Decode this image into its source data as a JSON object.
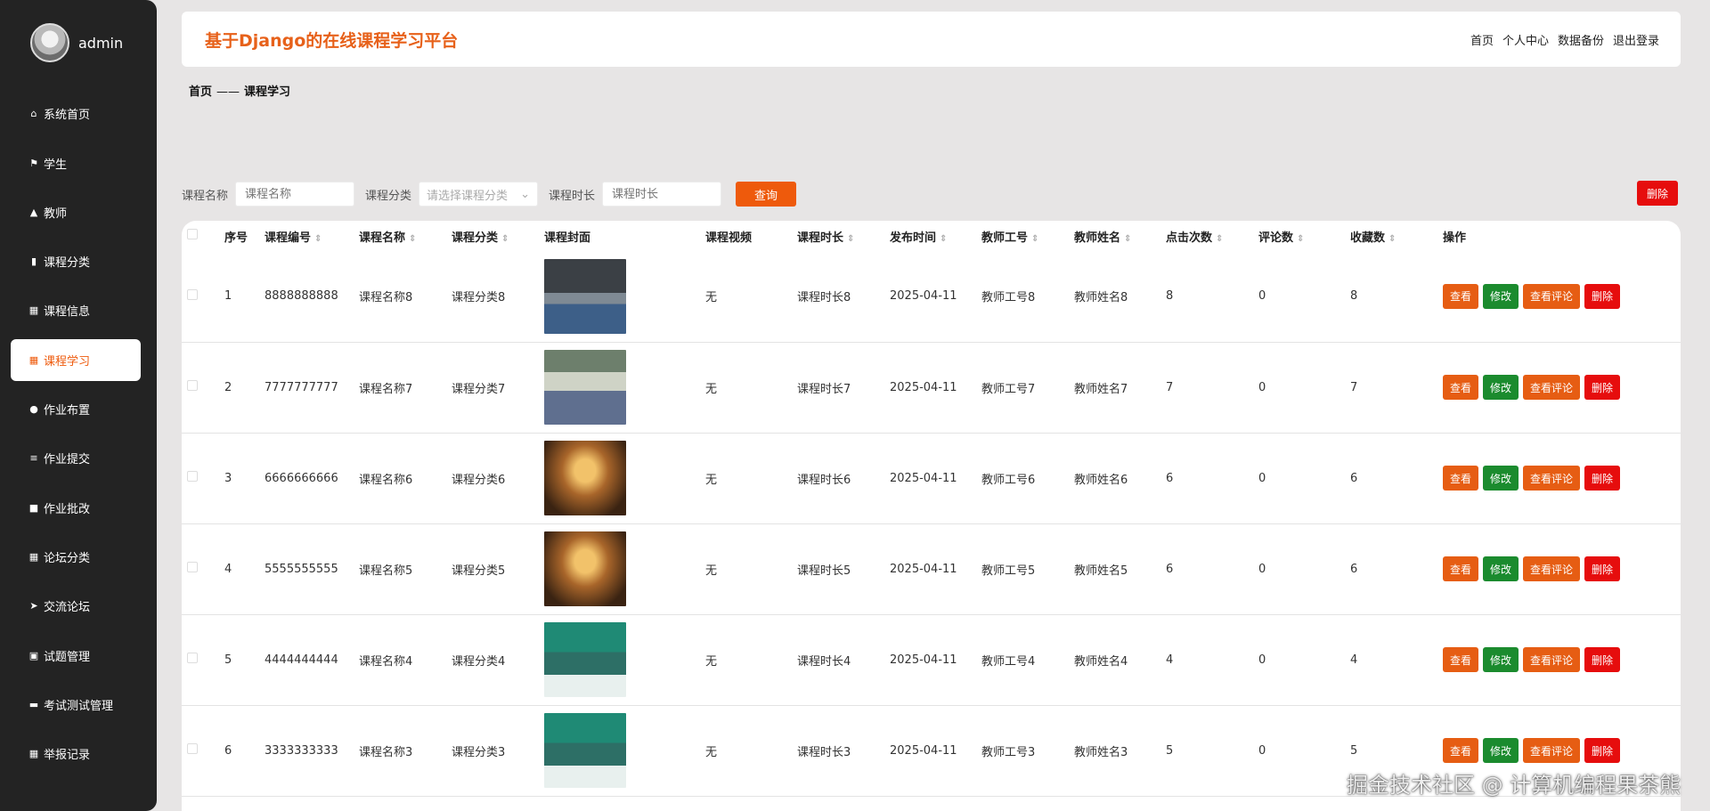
{
  "user": {
    "name": "admin"
  },
  "sidebar": {
    "items": [
      {
        "label": "系统首页",
        "icon": "home-icon",
        "glyph": "⌂",
        "active": false
      },
      {
        "label": "学生",
        "icon": "flag-icon",
        "glyph": "⚑",
        "active": false
      },
      {
        "label": "教师",
        "icon": "thumbs-up-icon",
        "glyph": "▲",
        "active": false
      },
      {
        "label": "课程分类",
        "icon": "chart-icon",
        "glyph": "▮",
        "active": false
      },
      {
        "label": "课程信息",
        "icon": "grid-icon",
        "glyph": "▦",
        "active": false
      },
      {
        "label": "课程学习",
        "icon": "grid-icon",
        "glyph": "▦",
        "active": true
      },
      {
        "label": "作业布置",
        "icon": "user-icon",
        "glyph": "●",
        "active": false
      },
      {
        "label": "作业提交",
        "icon": "list-icon",
        "glyph": "≡",
        "active": false
      },
      {
        "label": "作业批改",
        "icon": "briefcase-icon",
        "glyph": "■",
        "active": false
      },
      {
        "label": "论坛分类",
        "icon": "grid-icon",
        "glyph": "▦",
        "active": false
      },
      {
        "label": "交流论坛",
        "icon": "send-icon",
        "glyph": "➤",
        "active": false
      },
      {
        "label": "试题管理",
        "icon": "clipboard-icon",
        "glyph": "▣",
        "active": false
      },
      {
        "label": "考试测试管理",
        "icon": "comment-icon",
        "glyph": "▬",
        "active": false
      },
      {
        "label": "举报记录",
        "icon": "grid-icon",
        "glyph": "▦",
        "active": false
      }
    ]
  },
  "header": {
    "title": "基于Django的在线课程学习平台",
    "nav": [
      "首页",
      "个人中心",
      "数据备份",
      "退出登录"
    ]
  },
  "breadcrumb": {
    "home": "首页",
    "separator": "——",
    "current": "课程学习"
  },
  "search": {
    "name_label": "课程名称",
    "name_placeholder": "课程名称",
    "category_label": "课程分类",
    "category_placeholder": "请选择课程分类",
    "duration_label": "课程时长",
    "duration_placeholder": "课程时长",
    "query_button": "查询",
    "batch_delete_button": "删除"
  },
  "table": {
    "columns": [
      "序号",
      "课程编号",
      "课程名称",
      "课程分类",
      "课程封面",
      "课程视频",
      "课程时长",
      "发布时间",
      "教师工号",
      "教师姓名",
      "点击次数",
      "评论数",
      "收藏数",
      "操作"
    ],
    "actions": {
      "view": "查看",
      "edit": "修改",
      "comments": "查看评论",
      "delete": "删除"
    },
    "rows": [
      {
        "index": "1",
        "code": "8888888888",
        "name": "课程名称8",
        "category": "课程分类8",
        "cover": "kpi",
        "video": "无",
        "duration": "课程时长8",
        "date": "2025-04-11",
        "teacher_id": "教师工号8",
        "teacher_name": "教师姓名8",
        "clicks": "8",
        "comments": "0",
        "favorites": "8"
      },
      {
        "index": "2",
        "code": "7777777777",
        "name": "课程名称7",
        "category": "课程分类7",
        "cover": "classroom",
        "video": "无",
        "duration": "课程时长7",
        "date": "2025-04-11",
        "teacher_id": "教师工号7",
        "teacher_name": "教师姓名7",
        "clicks": "7",
        "comments": "0",
        "favorites": "7"
      },
      {
        "index": "3",
        "code": "6666666666",
        "name": "课程名称6",
        "category": "课程分类6",
        "cover": "book",
        "video": "无",
        "duration": "课程时长6",
        "date": "2025-04-11",
        "teacher_id": "教师工号6",
        "teacher_name": "教师姓名6",
        "clicks": "6",
        "comments": "0",
        "favorites": "6"
      },
      {
        "index": "4",
        "code": "5555555555",
        "name": "课程名称5",
        "category": "课程分类5",
        "cover": "book",
        "video": "无",
        "duration": "课程时长5",
        "date": "2025-04-11",
        "teacher_id": "教师工号5",
        "teacher_name": "教师姓名5",
        "clicks": "6",
        "comments": "0",
        "favorites": "6"
      },
      {
        "index": "5",
        "code": "4444444444",
        "name": "课程名称4",
        "category": "课程分类4",
        "cover": "teacher",
        "video": "无",
        "duration": "课程时长4",
        "date": "2025-04-11",
        "teacher_id": "教师工号4",
        "teacher_name": "教师姓名4",
        "clicks": "4",
        "comments": "0",
        "favorites": "4"
      },
      {
        "index": "6",
        "code": "3333333333",
        "name": "课程名称3",
        "category": "课程分类3",
        "cover": "teacher",
        "video": "无",
        "duration": "课程时长3",
        "date": "2025-04-11",
        "teacher_id": "教师工号3",
        "teacher_name": "教师姓名3",
        "clicks": "5",
        "comments": "0",
        "favorites": "5"
      }
    ]
  },
  "watermark": "掘金技术社区 @ 计算机编程果茶熊"
}
